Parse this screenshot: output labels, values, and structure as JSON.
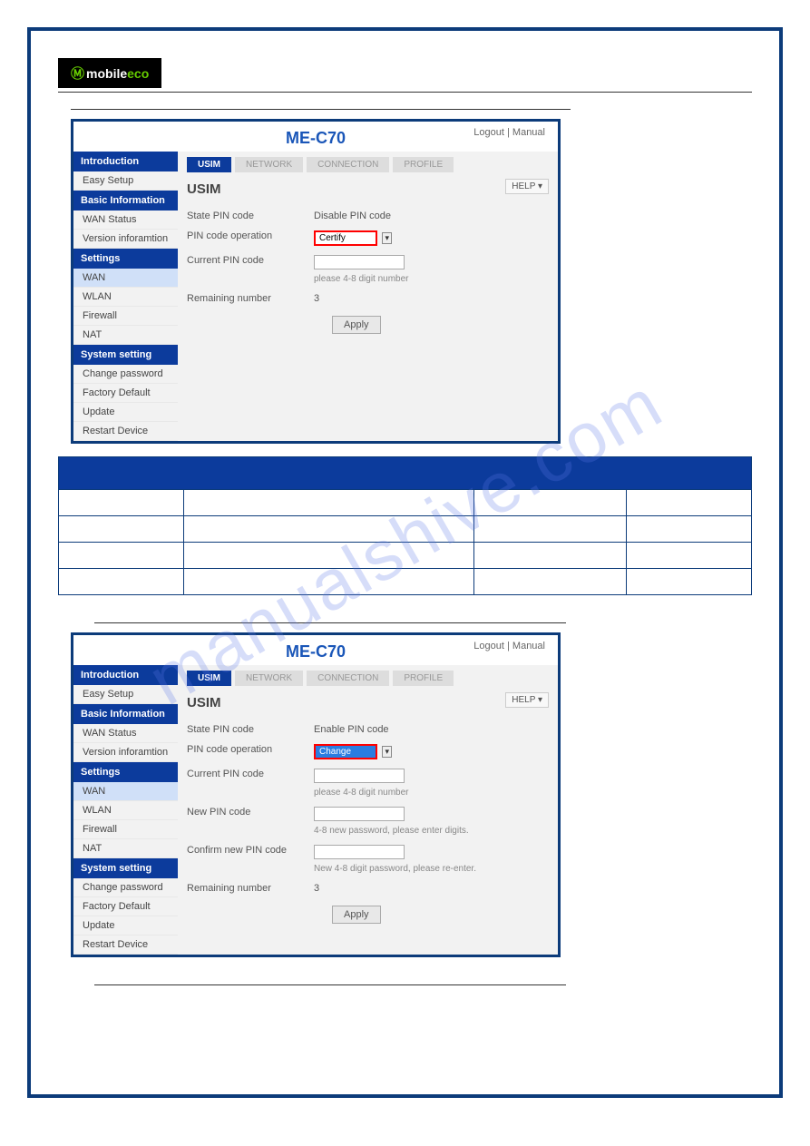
{
  "logo": {
    "brand_prefix": "mobile",
    "brand_suffix": "eco"
  },
  "watermark": "manualshive.com",
  "screenshot1": {
    "title": "ME-C70",
    "links": "Logout | Manual",
    "help": "HELP ▾",
    "content_title": "USIM",
    "sidebar": {
      "groups": [
        {
          "head": "Introduction",
          "items": [
            "Easy Setup"
          ]
        },
        {
          "head": "Basic Information",
          "items": [
            "WAN Status",
            "Version inforamtion"
          ]
        },
        {
          "head": "Settings",
          "items": [
            "WAN",
            "WLAN",
            "Firewall",
            "NAT"
          ]
        },
        {
          "head": "System setting",
          "items": [
            "Change password",
            "Factory Default",
            "Update",
            "Restart Device"
          ]
        }
      ],
      "active": "WAN"
    },
    "tabs": [
      "USIM",
      "NETWORK",
      "CONNECTION",
      "PROFILE"
    ],
    "rows": {
      "state_label": "State PIN code",
      "state_value": "Disable PIN code",
      "op_label": "PIN code operation",
      "op_value": "Certify",
      "current_label": "Current PIN code",
      "current_note": "please 4-8 digit number",
      "remain_label": "Remaining number",
      "remain_value": "3"
    },
    "apply": "Apply"
  },
  "table": {
    "cols": 4,
    "rows": 4
  },
  "screenshot2": {
    "title": "ME-C70",
    "links": "Logout | Manual",
    "help": "HELP ▾",
    "content_title": "USIM",
    "sidebar": {
      "groups": [
        {
          "head": "Introduction",
          "items": [
            "Easy Setup"
          ]
        },
        {
          "head": "Basic Information",
          "items": [
            "WAN Status",
            "Version inforamtion"
          ]
        },
        {
          "head": "Settings",
          "items": [
            "WAN",
            "WLAN",
            "Firewall",
            "NAT"
          ]
        },
        {
          "head": "System setting",
          "items": [
            "Change password",
            "Factory Default",
            "Update",
            "Restart Device"
          ]
        }
      ],
      "active": "WAN"
    },
    "tabs": [
      "USIM",
      "NETWORK",
      "CONNECTION",
      "PROFILE"
    ],
    "rows": {
      "state_label": "State PIN code",
      "state_value": "Enable PIN code",
      "op_label": "PIN code operation",
      "op_value": "Change",
      "current_label": "Current PIN code",
      "current_note": "please 4-8 digit number",
      "new_label": "New PIN code",
      "new_note": "4-8 new password, please enter digits.",
      "confirm_label": "Confirm new PIN code",
      "confirm_note": "New 4-8 digit password, please re-enter.",
      "remain_label": "Remaining number",
      "remain_value": "3"
    },
    "apply": "Apply"
  }
}
